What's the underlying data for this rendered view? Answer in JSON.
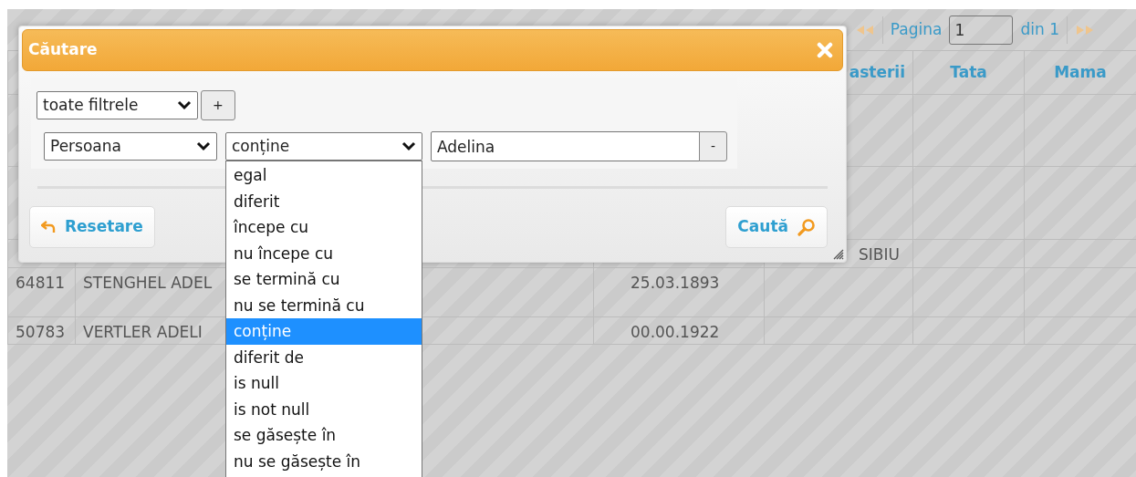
{
  "pager": {
    "prev": {
      "disabled": true
    },
    "label": "Pagina",
    "page": "1",
    "total": "din 1",
    "next": {
      "disabled": true
    }
  },
  "table": {
    "headers": [
      "asterii",
      "Tata",
      "Mama"
    ],
    "rows": [
      {
        "place": "SIBIU"
      },
      {
        "id": "64811",
        "name": "STENGHEL ADEL",
        "date": "25.03.1893"
      },
      {
        "id": "50783",
        "name": "VERTLER ADELI",
        "date": "00.00.1922"
      }
    ]
  },
  "dialog": {
    "title": "Căutare",
    "group_operator": "toate filtrele",
    "add_label": "+",
    "rules": [
      {
        "field": "Persoana",
        "operator": "conține",
        "value": "Adelina",
        "remove_label": "-"
      }
    ],
    "operator_menu": {
      "open": true,
      "options": [
        {
          "label": "egal",
          "selected": false
        },
        {
          "label": "diferit",
          "selected": false
        },
        {
          "label": "începe cu",
          "selected": false
        },
        {
          "label": "nu începe cu",
          "selected": false
        },
        {
          "label": "se termină cu",
          "selected": false
        },
        {
          "label": "nu se termină cu",
          "selected": false
        },
        {
          "label": "conține",
          "selected": true
        },
        {
          "label": "diferit de",
          "selected": false
        },
        {
          "label": "is null",
          "selected": false
        },
        {
          "label": "is not null",
          "selected": false
        },
        {
          "label": "se găsește în",
          "selected": false
        },
        {
          "label": "nu se găsește în",
          "selected": false
        }
      ]
    },
    "buttons": [
      {
        "kind": "reset",
        "label": "Resetare"
      },
      {
        "kind": "search",
        "label": "Caută"
      }
    ]
  }
}
